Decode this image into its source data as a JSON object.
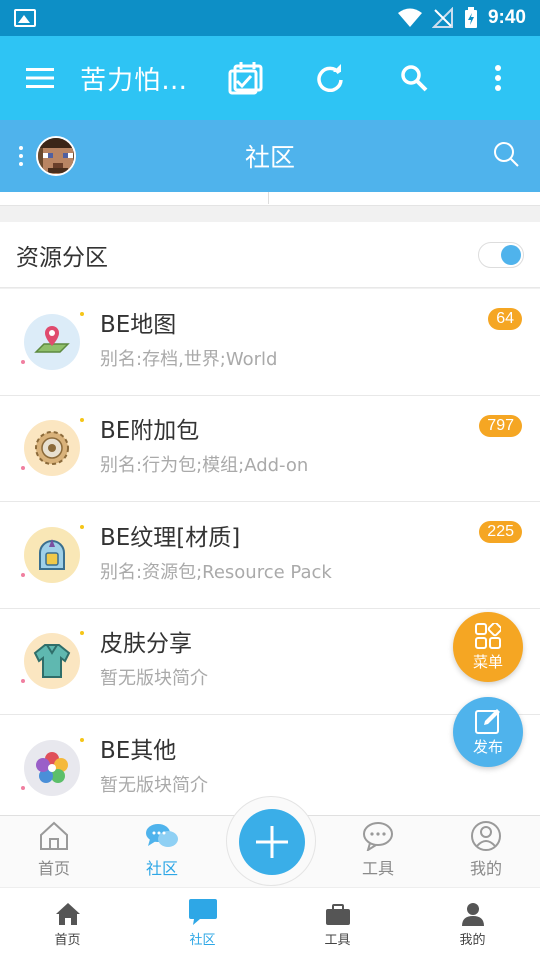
{
  "status_bar": {
    "time": "9:40"
  },
  "app_bar": {
    "title": "苦力怕…"
  },
  "community_bar": {
    "title": "社区"
  },
  "section": {
    "title": "资源分区",
    "toggle_on": true
  },
  "forums": [
    {
      "name": "BE地图",
      "desc": "别名:存档,世界;World",
      "badge": "64",
      "icon": "map-icon",
      "color": "#dcecf8"
    },
    {
      "name": "BE附加包",
      "desc": "别名:行为包;模组;Add-on",
      "badge": "797",
      "icon": "gear-icon",
      "color": "#fbe6c1"
    },
    {
      "name": "BE纹理[材质]",
      "desc": "别名:资源包;Resource Pack",
      "badge": "225",
      "icon": "helmet-icon",
      "color": "#f9e7b6"
    },
    {
      "name": "皮肤分享",
      "desc": "暂无版块简介",
      "badge": "",
      "icon": "sweater-icon",
      "color": "#fbe6c1"
    },
    {
      "name": "BE其他",
      "desc": "暂无版块简介",
      "badge": "",
      "icon": "flower-icon",
      "color": "#e8e8ee"
    }
  ],
  "fab": {
    "menu_label": "菜单",
    "post_label": "发布"
  },
  "inner_tabs": [
    {
      "label": "首页",
      "icon": "home-icon",
      "active": false
    },
    {
      "label": "社区",
      "icon": "chat-icon",
      "active": true
    },
    {
      "label": "工具",
      "icon": "message-icon",
      "active": false
    },
    {
      "label": "我的",
      "icon": "user-icon",
      "active": false
    }
  ],
  "bottom_nav": [
    {
      "label": "首页",
      "icon": "home-icon",
      "active": false
    },
    {
      "label": "社区",
      "icon": "chat-bubble-icon",
      "active": true
    },
    {
      "label": "工具",
      "icon": "briefcase-icon",
      "active": false
    },
    {
      "label": "我的",
      "icon": "person-icon",
      "active": false
    }
  ],
  "colors": {
    "status": "#0d8fc6",
    "appbar": "#2ec4f4",
    "community": "#4fb3ec",
    "accent": "#2ea7e6",
    "badge": "#f5a623"
  }
}
